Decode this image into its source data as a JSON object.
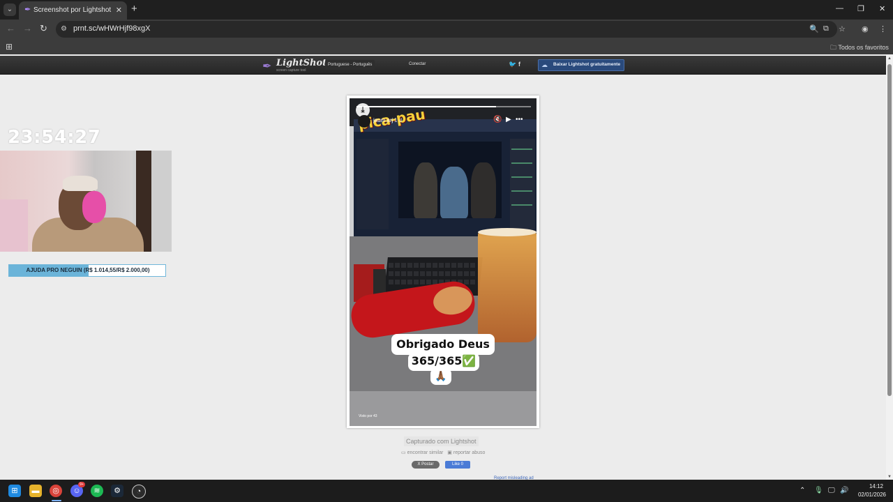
{
  "browser": {
    "tab_title": "Screenshot por Lightshot",
    "tab_close": "✕",
    "new_tab": "+",
    "url": "prnt.sc/wHWrHjf98xgX",
    "bookmarks_folder": "Todos os favoritos"
  },
  "lightshot": {
    "logo": "LightShot",
    "tagline": "screen capture tool",
    "language": "Portuguese - Português",
    "connect": "Conectar",
    "twitter": "t",
    "facebook": "f",
    "download": "Baixar Lightshot gratuitamente",
    "captured_with": "Capturado com Lightshot",
    "find_similar": "encontrar similar",
    "report_abuse": "reportar abuso",
    "x_post": "X Postar",
    "fb_like": "Like 0",
    "report_ad": "Report misleading ad"
  },
  "story": {
    "username": "jaum.arj",
    "time_ago": "1 d",
    "caption_line1": "Obrigado Deus",
    "caption_line2": "365/365✅",
    "caption_emoji": "🙏🏾",
    "viewers": "Visto por 43",
    "progress_fraction": 0.8,
    "cookie_brand": "pica-pau",
    "mute_icon": "🔇",
    "play_icon": "▶",
    "more_icon": "•••",
    "save_icon": "⤓"
  },
  "stream_overlay": {
    "clock": "23:54:27",
    "goal_label": "AJUDA PRO NEGUIN (R$ 1.014,55/R$ 2.000,00)",
    "goal_fraction": 0.507
  },
  "taskbar": {
    "time": "14:12",
    "date": "02/01/2026",
    "discord_badge": "9+"
  },
  "colors": {
    "accent_blue": "#6bb4d9",
    "lightshot_purple": "#9b7bd4"
  }
}
